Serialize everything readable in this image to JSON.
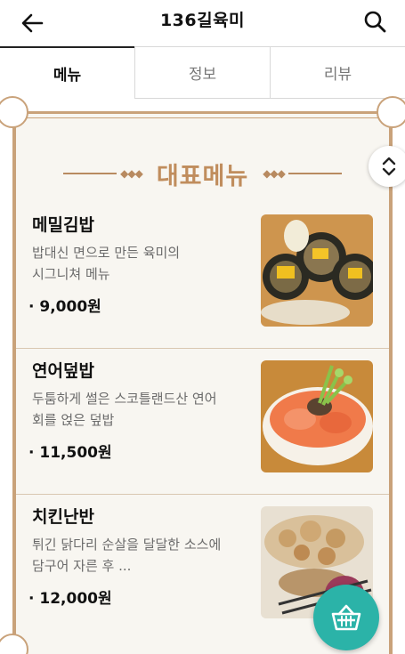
{
  "header": {
    "title": "136길육미",
    "back_icon": "arrow-left-icon",
    "search_icon": "search-icon"
  },
  "tabs": [
    {
      "label": "메뉴",
      "active": true
    },
    {
      "label": "정보",
      "active": false
    },
    {
      "label": "리뷰",
      "active": false
    }
  ],
  "section": {
    "heading": "대표메뉴"
  },
  "menu": [
    {
      "name": "메밀김밥",
      "desc_line1": "밥대신 면으로 만든 육미의",
      "desc_line2": "시그니쳐 메뉴",
      "price": "9,000원",
      "image_icon": "soba-kimbap-photo"
    },
    {
      "name": "연어덮밥",
      "desc_line1": "두툼하게 썰은 스코틀랜드산 연어",
      "desc_line2": "회를 얹은 덮밥",
      "price": "11,500원",
      "image_icon": "salmon-rice-bowl-photo"
    },
    {
      "name": "치킨난반",
      "desc_line1": "튀긴 닭다리 순살을 달달한 소스에",
      "desc_line2": "담구어 자른 후 ...",
      "price": "12,000원",
      "image_icon": "chicken-nanban-photo"
    }
  ],
  "colors": {
    "accent": "#c08d5d",
    "frame": "#c9a27a",
    "cart_button": "#2bb3a8"
  }
}
